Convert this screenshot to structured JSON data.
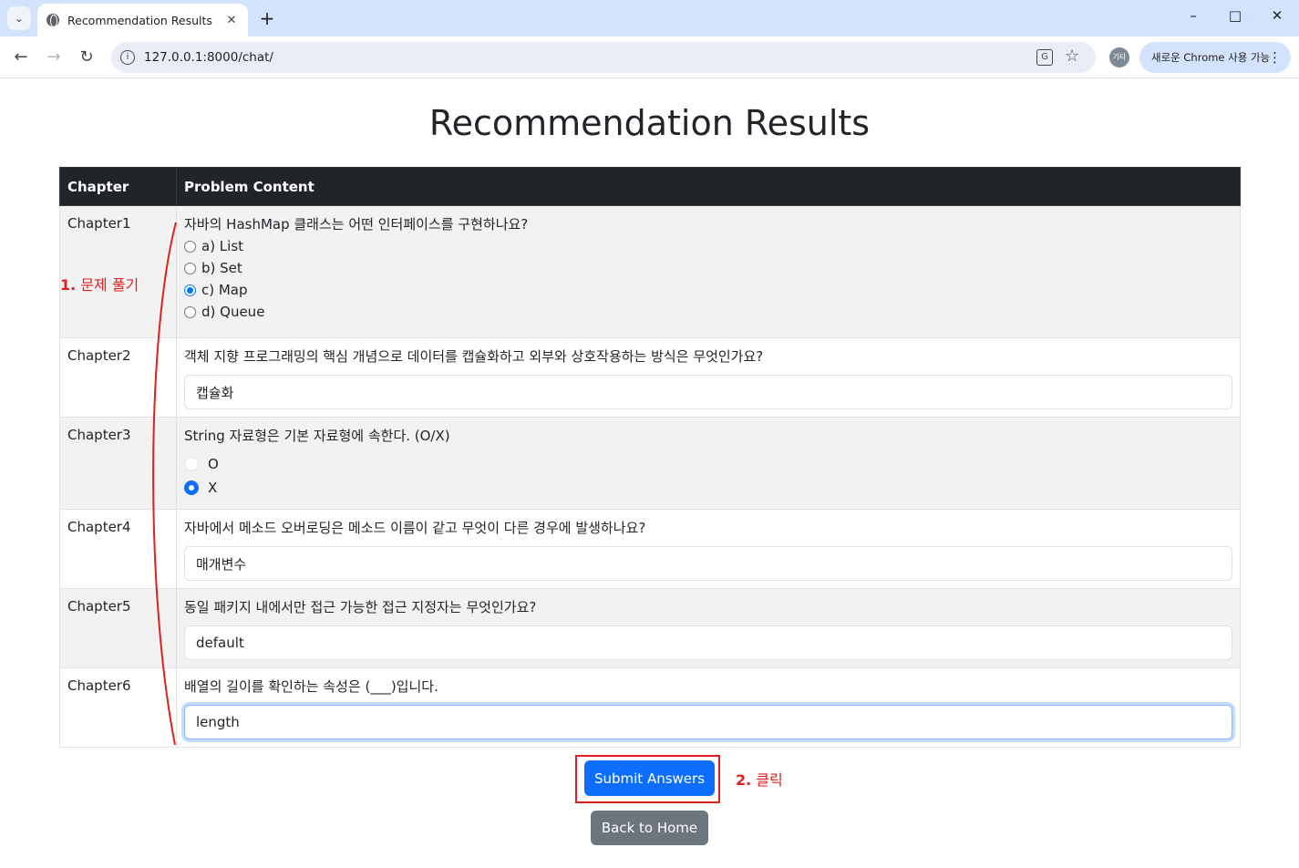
{
  "browser": {
    "tab_title": "Recommendation Results",
    "url": "127.0.0.1:8000/chat/",
    "profile_label": "기타",
    "update_label": "새로운 Chrome 사용 가능"
  },
  "page": {
    "title": "Recommendation Results",
    "headers": {
      "chapter": "Chapter",
      "content": "Problem Content"
    },
    "rows": [
      {
        "chapter": "Chapter1",
        "question": "자바의 HashMap 클래스는 어떤 인터페이스를 구현하나요?",
        "type": "multiple_choice",
        "options": [
          "a) List",
          "b) Set",
          "c) Map",
          "d) Queue"
        ],
        "selected": "c) Map"
      },
      {
        "chapter": "Chapter2",
        "question": "객체 지향 프로그래밍의 핵심 개념으로 데이터를 캡슐화하고 외부와 상호작용하는 방식은 무엇인가요?",
        "type": "text",
        "answer": "캡슐화"
      },
      {
        "chapter": "Chapter3",
        "question": "String 자료형은 기본 자료형에 속한다. (O/X)",
        "type": "ox",
        "options": [
          "O",
          "X"
        ],
        "selected": "X"
      },
      {
        "chapter": "Chapter4",
        "question": "자바에서 메소드 오버로딩은 메소드 이름이 같고 무엇이 다른 경우에 발생하나요?",
        "type": "text",
        "answer": "매개변수"
      },
      {
        "chapter": "Chapter5",
        "question": "동일 패키지 내에서만 접근 가능한 접근 지정자는 무엇인가요?",
        "type": "text",
        "answer": "default"
      },
      {
        "chapter": "Chapter6",
        "question": "배열의 길이를 확인하는 속성은 (___)입니다.",
        "type": "text",
        "answer": "length"
      }
    ],
    "submit_label": "Submit Answers",
    "home_label": "Back to Home"
  },
  "annotations": {
    "step1_number": "1.",
    "step1_text": "문제 풀기",
    "step2_number": "2.",
    "step2_text": "클릭",
    "color": "#e02020"
  }
}
